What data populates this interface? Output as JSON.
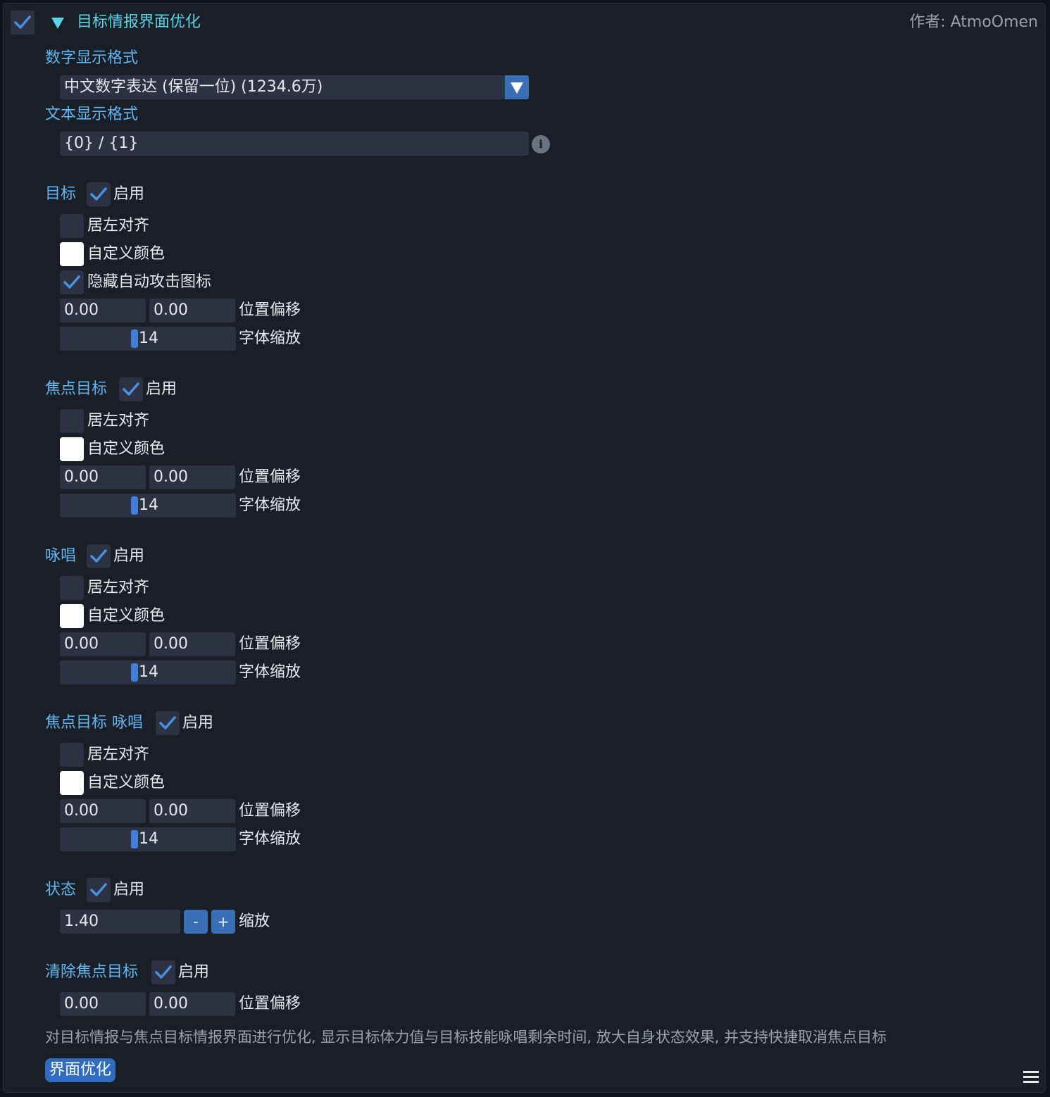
{
  "header": {
    "title": "目标情报界面优化",
    "author": "作者: AtmoOmen",
    "expanded_icon": "triangle-down-icon"
  },
  "number_format": {
    "label": "数字显示格式",
    "selected": "中文数字表达 (保留一位) (1234.6万)"
  },
  "text_format": {
    "label": "文本显示格式",
    "value": "{0} / {1}"
  },
  "common": {
    "enable": "启用",
    "align_left": "居左对齐",
    "custom_color": "自定义颜色",
    "position_offset": "位置偏移",
    "font_scale": "字体缩放",
    "scale": "缩放"
  },
  "sections": {
    "target": {
      "title": "目标",
      "enabled": true,
      "align_left": false,
      "custom_color": false,
      "hide_auto_attack": true,
      "hide_auto_attack_label": "隐藏自动攻击图标",
      "offset_x": "0.00",
      "offset_y": "0.00",
      "font_scale": "14"
    },
    "focus": {
      "title": "焦点目标",
      "enabled": true,
      "align_left": false,
      "custom_color": false,
      "offset_x": "0.00",
      "offset_y": "0.00",
      "font_scale": "14"
    },
    "cast": {
      "title": "咏唱",
      "enabled": true,
      "align_left": false,
      "custom_color": false,
      "offset_x": "0.00",
      "offset_y": "0.00",
      "font_scale": "14"
    },
    "focus_cast": {
      "title": "焦点目标 咏唱",
      "enabled": true,
      "align_left": false,
      "custom_color": false,
      "offset_x": "0.00",
      "offset_y": "0.00",
      "font_scale": "14"
    },
    "status": {
      "title": "状态",
      "enabled": true,
      "scale_value": "1.40",
      "minus": "-",
      "plus": "+"
    },
    "clear_focus": {
      "title": "清除焦点目标",
      "enabled": true,
      "offset_x": "0.00",
      "offset_y": "0.00"
    }
  },
  "description": "对目标情报与焦点目标情报界面进行优化, 显示目标体力值与目标技能咏唱剩余时间, 放大自身状态效果, 并支持快捷取消焦点目标",
  "tag": "界面优化",
  "colors": {
    "background": "#1a1e27",
    "control": "#2c3241",
    "accent": "#3a6fb8",
    "section_label": "#5fb6f0",
    "title": "#58d6e6"
  }
}
